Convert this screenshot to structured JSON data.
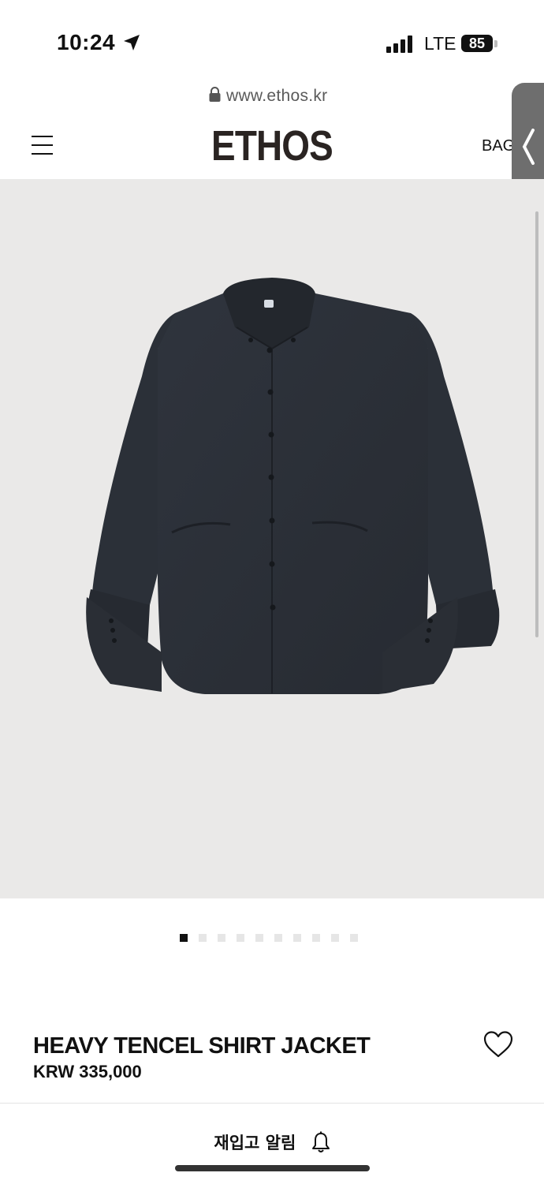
{
  "status_bar": {
    "time": "10:24",
    "network": "LTE",
    "battery": "85"
  },
  "browser": {
    "url": "www.ethos.kr"
  },
  "header": {
    "logo": "ETHOS",
    "bag_label": "BAG"
  },
  "product": {
    "image_alt": "dark grey shirt jacket",
    "image_count": 10,
    "active_image_index": 0,
    "name": "HEAVY TENCEL SHIRT JACKET",
    "price": "KRW 335,000"
  },
  "actions": {
    "restock_label": "재입고 알림"
  },
  "colors": {
    "accent": "#111111",
    "image_bg": "#eae9e8",
    "garment": "#2c3139"
  }
}
